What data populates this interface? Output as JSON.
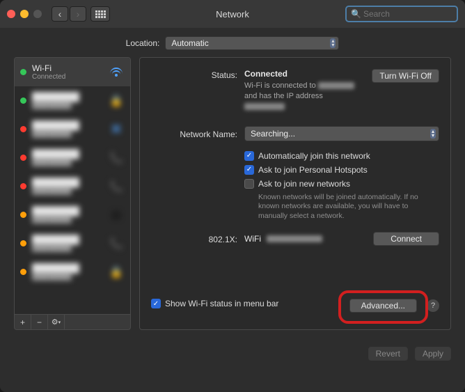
{
  "window": {
    "title": "Network"
  },
  "search": {
    "placeholder": "Search"
  },
  "location": {
    "label": "Location:",
    "value": "Automatic"
  },
  "sidebar": {
    "items": [
      {
        "name": "Wi-Fi",
        "sub": "Connected",
        "color": "#35c759",
        "icon": "wifi"
      },
      {
        "name": "████████",
        "sub": "████████",
        "color": "#35c759",
        "icon": "lock"
      },
      {
        "name": "████████",
        "sub": "████████",
        "color": "#ff3b30",
        "icon": "bt"
      },
      {
        "name": "████████",
        "sub": "████████",
        "color": "#ff3b30",
        "icon": "phone"
      },
      {
        "name": "████████",
        "sub": "████████",
        "color": "#ff3b30",
        "icon": "phone"
      },
      {
        "name": "████████",
        "sub": "████████",
        "color": "#ff9f0a",
        "icon": "bridge"
      },
      {
        "name": "████████",
        "sub": "████████",
        "color": "#ff9f0a",
        "icon": "phone"
      },
      {
        "name": "████████",
        "sub": "████████",
        "color": "#ff9f0a",
        "icon": "lock"
      }
    ]
  },
  "detail": {
    "status_label": "Status:",
    "status_value": "Connected",
    "wifi_off_btn": "Turn Wi-Fi Off",
    "status_sub_pre": "Wi-Fi is connected to ",
    "status_sub_post": " and has the IP address ",
    "netname_label": "Network Name:",
    "netname_value": "Searching...",
    "auto_join": "Automatically join this network",
    "ask_hotspot": "Ask to join Personal Hotspots",
    "ask_new": "Ask to join new networks",
    "ask_new_help": "Known networks will be joined automatically. If no known networks are available, you will have to manually select a network.",
    "dot1x_label": "802.1X:",
    "dot1x_value": "WiFi",
    "connect_btn": "Connect",
    "show_status": "Show Wi-Fi status in menu bar",
    "advanced_btn": "Advanced...",
    "revert_btn": "Revert",
    "apply_btn": "Apply"
  }
}
